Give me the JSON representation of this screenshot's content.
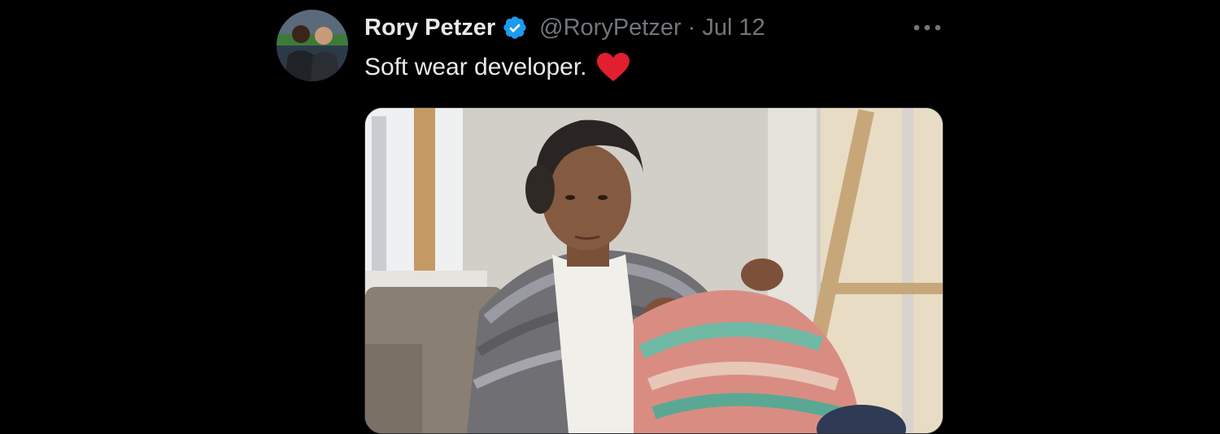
{
  "tweet": {
    "author_name": "Rory Petzer",
    "handle": "@RoryPetzer",
    "separator": "·",
    "date": "Jul 12",
    "text": "Soft wear developer.",
    "icons": {
      "verified": "verified-badge-icon",
      "more": "more-options-icon",
      "heart": "red-heart-emoji"
    },
    "colors": {
      "background": "#000000",
      "primary_text": "#e7e9ea",
      "secondary_text": "#71767b",
      "verified": "#1d9bf0",
      "heart": "#e0202e"
    }
  }
}
